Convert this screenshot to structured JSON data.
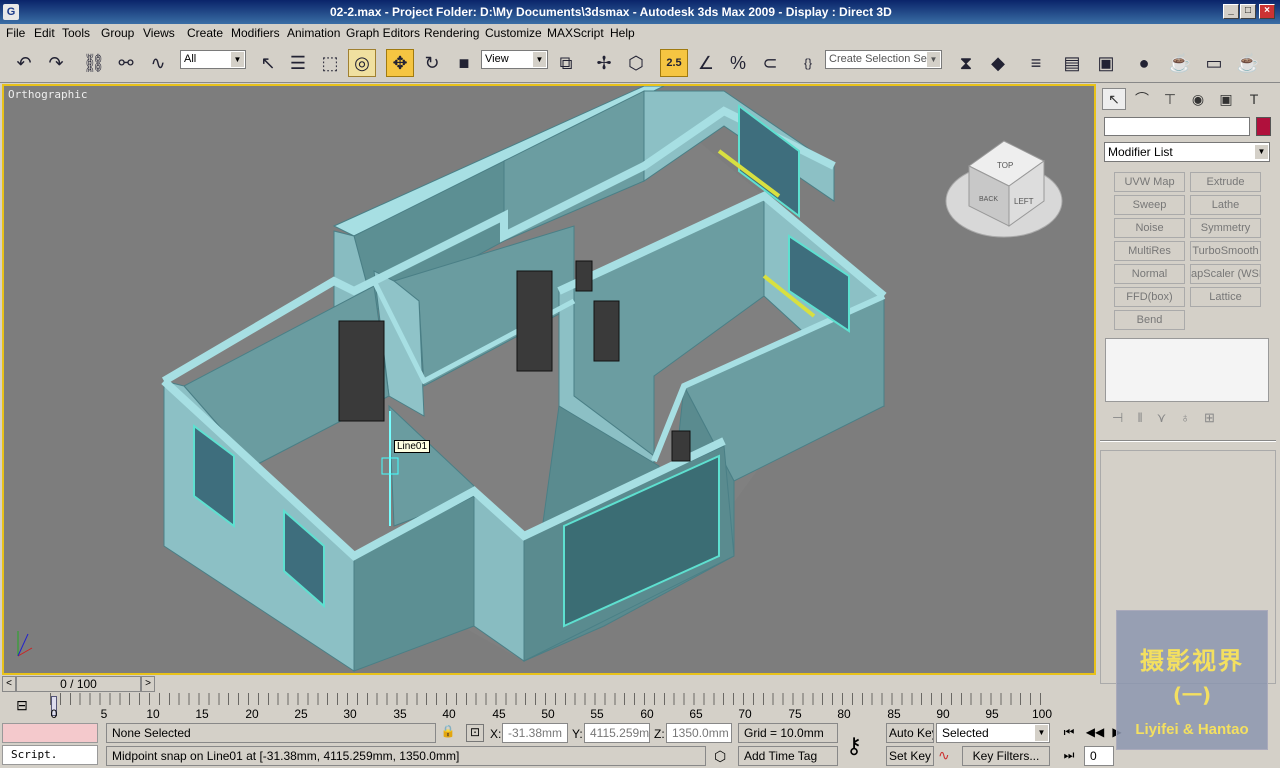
{
  "window": {
    "title": "02-2.max     - Project Folder: D:\\My Documents\\3dsmax     - Autodesk 3ds Max  2009      - Display : Direct 3D",
    "controls": [
      "_",
      "□",
      "×"
    ]
  },
  "menu": [
    "File",
    "Edit",
    "Tools",
    "Group",
    "Views",
    "Create",
    "Modifiers",
    "Animation",
    "Graph Editors",
    "Rendering",
    "Customize",
    "MAXScript",
    "Help"
  ],
  "toolbar": {
    "selection_filter": "All",
    "ref_coord": "View",
    "snap_value": "2.5",
    "named_selection": "Create Selection Set"
  },
  "viewport": {
    "label": "Orthographic",
    "tooltip": "Line01",
    "viewcube": {
      "top": "TOP",
      "left": "LEFT",
      "back": "BACK"
    }
  },
  "command_panel": {
    "name_value": "",
    "color": "#b0103c",
    "modifier_list": "Modifier List",
    "buttons": [
      "UVW Map",
      "Extrude",
      "Sweep",
      "Lathe",
      "Noise",
      "Symmetry",
      "MultiRes",
      "TurboSmooth",
      "Normal",
      "apScaler (WSM",
      "FFD(box)",
      "Lattice",
      "Bend"
    ]
  },
  "timeline": {
    "frame": "0 / 100",
    "ticks": [
      "0",
      "5",
      "10",
      "15",
      "20",
      "25",
      "30",
      "35",
      "40",
      "45",
      "50",
      "55",
      "60",
      "65",
      "70",
      "75",
      "80",
      "85",
      "90",
      "95",
      "100"
    ]
  },
  "status": {
    "script": "Script.",
    "selection": "None Selected",
    "prompt": "Midpoint snap on Line01 at [-31.38mm, 4115.259mm, 1350.0mm]",
    "x_label": "X:",
    "x": "-31.38mm",
    "y_label": "Y:",
    "y": "4115.259m",
    "z_label": "Z:",
    "z": "1350.0mm",
    "grid": "Grid = 10.0mm",
    "add_time_tag": "Add Time Tag",
    "auto_key": "Auto Key",
    "set_key": "Set Key",
    "key_mode": "Selected",
    "key_filters": "Key Filters...",
    "current_frame": "0"
  },
  "watermark": {
    "title": "摄影视界",
    "subtitle": "(一)",
    "credit": "Liyifei & Hantao"
  }
}
